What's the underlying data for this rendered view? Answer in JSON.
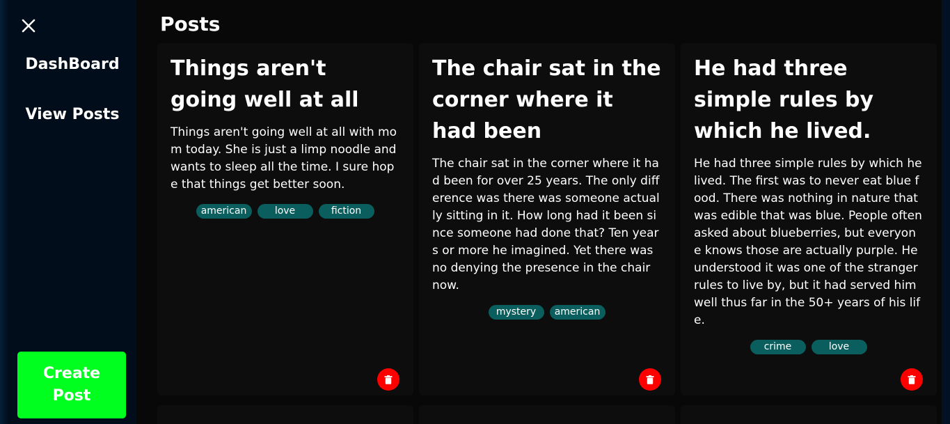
{
  "sidebar": {
    "close_icon": "close-icon",
    "items": [
      {
        "label": "DashBoard"
      },
      {
        "label": "View Posts"
      }
    ],
    "create_label": "Create Post",
    "create_color": "#00ff1e"
  },
  "main": {
    "title": "Posts"
  },
  "posts": [
    {
      "title": "Things aren't going well at all",
      "body": "Things aren't going well at all with mom today. She is just a limp noodle and wants to sleep all the time. I sure hope that things get better soon.",
      "tags": [
        "american",
        "love",
        "fiction"
      ]
    },
    {
      "title": "The chair sat in the corner where it had been",
      "body": "The chair sat in the corner where it had been for over 25 years. The only difference was there was someone actually sitting in it. How long had it been since someone had done that? Ten years or more he imagined. Yet there was no denying the presence in the chair now.",
      "tags": [
        "mystery",
        "american"
      ]
    },
    {
      "title": "He had three simple rules by which he lived.",
      "body": "He had three simple rules by which he lived. The first was to never eat blue food. There was nothing in nature that was edible that was blue. People often asked about blueberries, but everyone knows those are actually purple. He understood it was one of the stranger rules to live by, but it had served him well thus far in the 50+ years of his life.",
      "tags": [
        "crime",
        "love"
      ]
    }
  ],
  "colors": {
    "tag_bg": "#0b5e5e",
    "delete_bg": "#ff0000"
  }
}
